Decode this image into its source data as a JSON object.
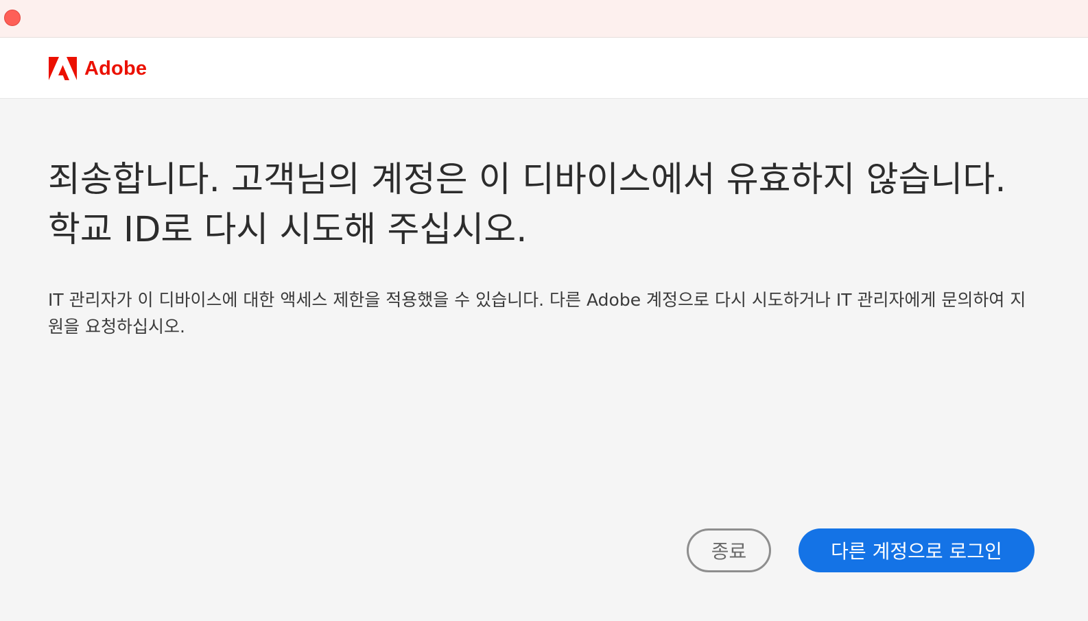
{
  "titlebar": {
    "close_icon": "close-dot-icon",
    "close_color": "#fe5f57"
  },
  "brand": {
    "logo_icon": "adobe-logo-icon",
    "name": "Adobe",
    "color": "#eb1000"
  },
  "main": {
    "heading": "죄송합니다. 고객님의 계정은 이 디바이스에서 유효하지 않습니다. 학교 ID로 다시 시도해 주십시오.",
    "description": "IT 관리자가 이 디바이스에 대한 액세스 제한을 적용했을 수 있습니다. 다른 Adobe 계정으로 다시 시도하거나 IT 관리자에게 문의하여 지원을 요청하십시오."
  },
  "actions": {
    "quit_label": "종료",
    "signin_other_label": "다른 계정으로 로그인",
    "primary_color": "#1473e6"
  }
}
